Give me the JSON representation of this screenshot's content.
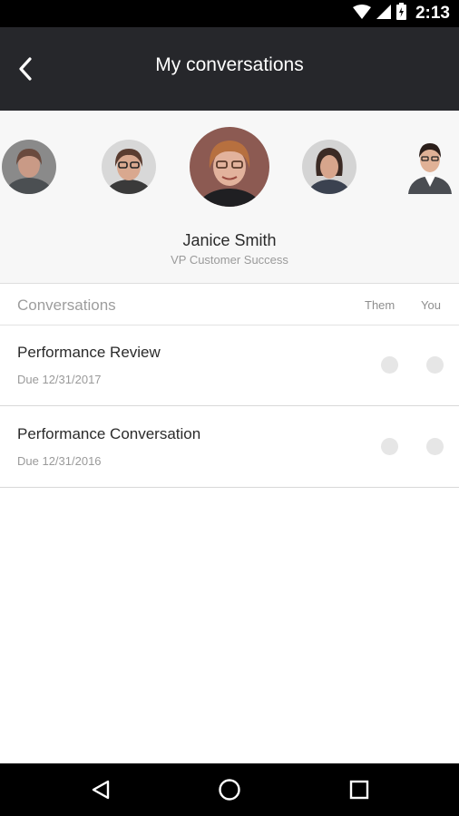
{
  "status_bar": {
    "time": "2:13"
  },
  "app_bar": {
    "title": "My conversations"
  },
  "selected_person": {
    "name": "Janice Smith",
    "title": "VP Customer Success"
  },
  "list": {
    "header": "Conversations",
    "columns": {
      "them": "Them",
      "you": "You"
    },
    "rows": [
      {
        "title": "Performance Review",
        "due": "Due 12/31/2017"
      },
      {
        "title": "Performance Conversation",
        "due": "Due 12/31/2016"
      }
    ]
  },
  "colors": {
    "app_bar": "#26272b",
    "status_dot": "#e6e6e6",
    "panel": "#f7f7f7"
  }
}
